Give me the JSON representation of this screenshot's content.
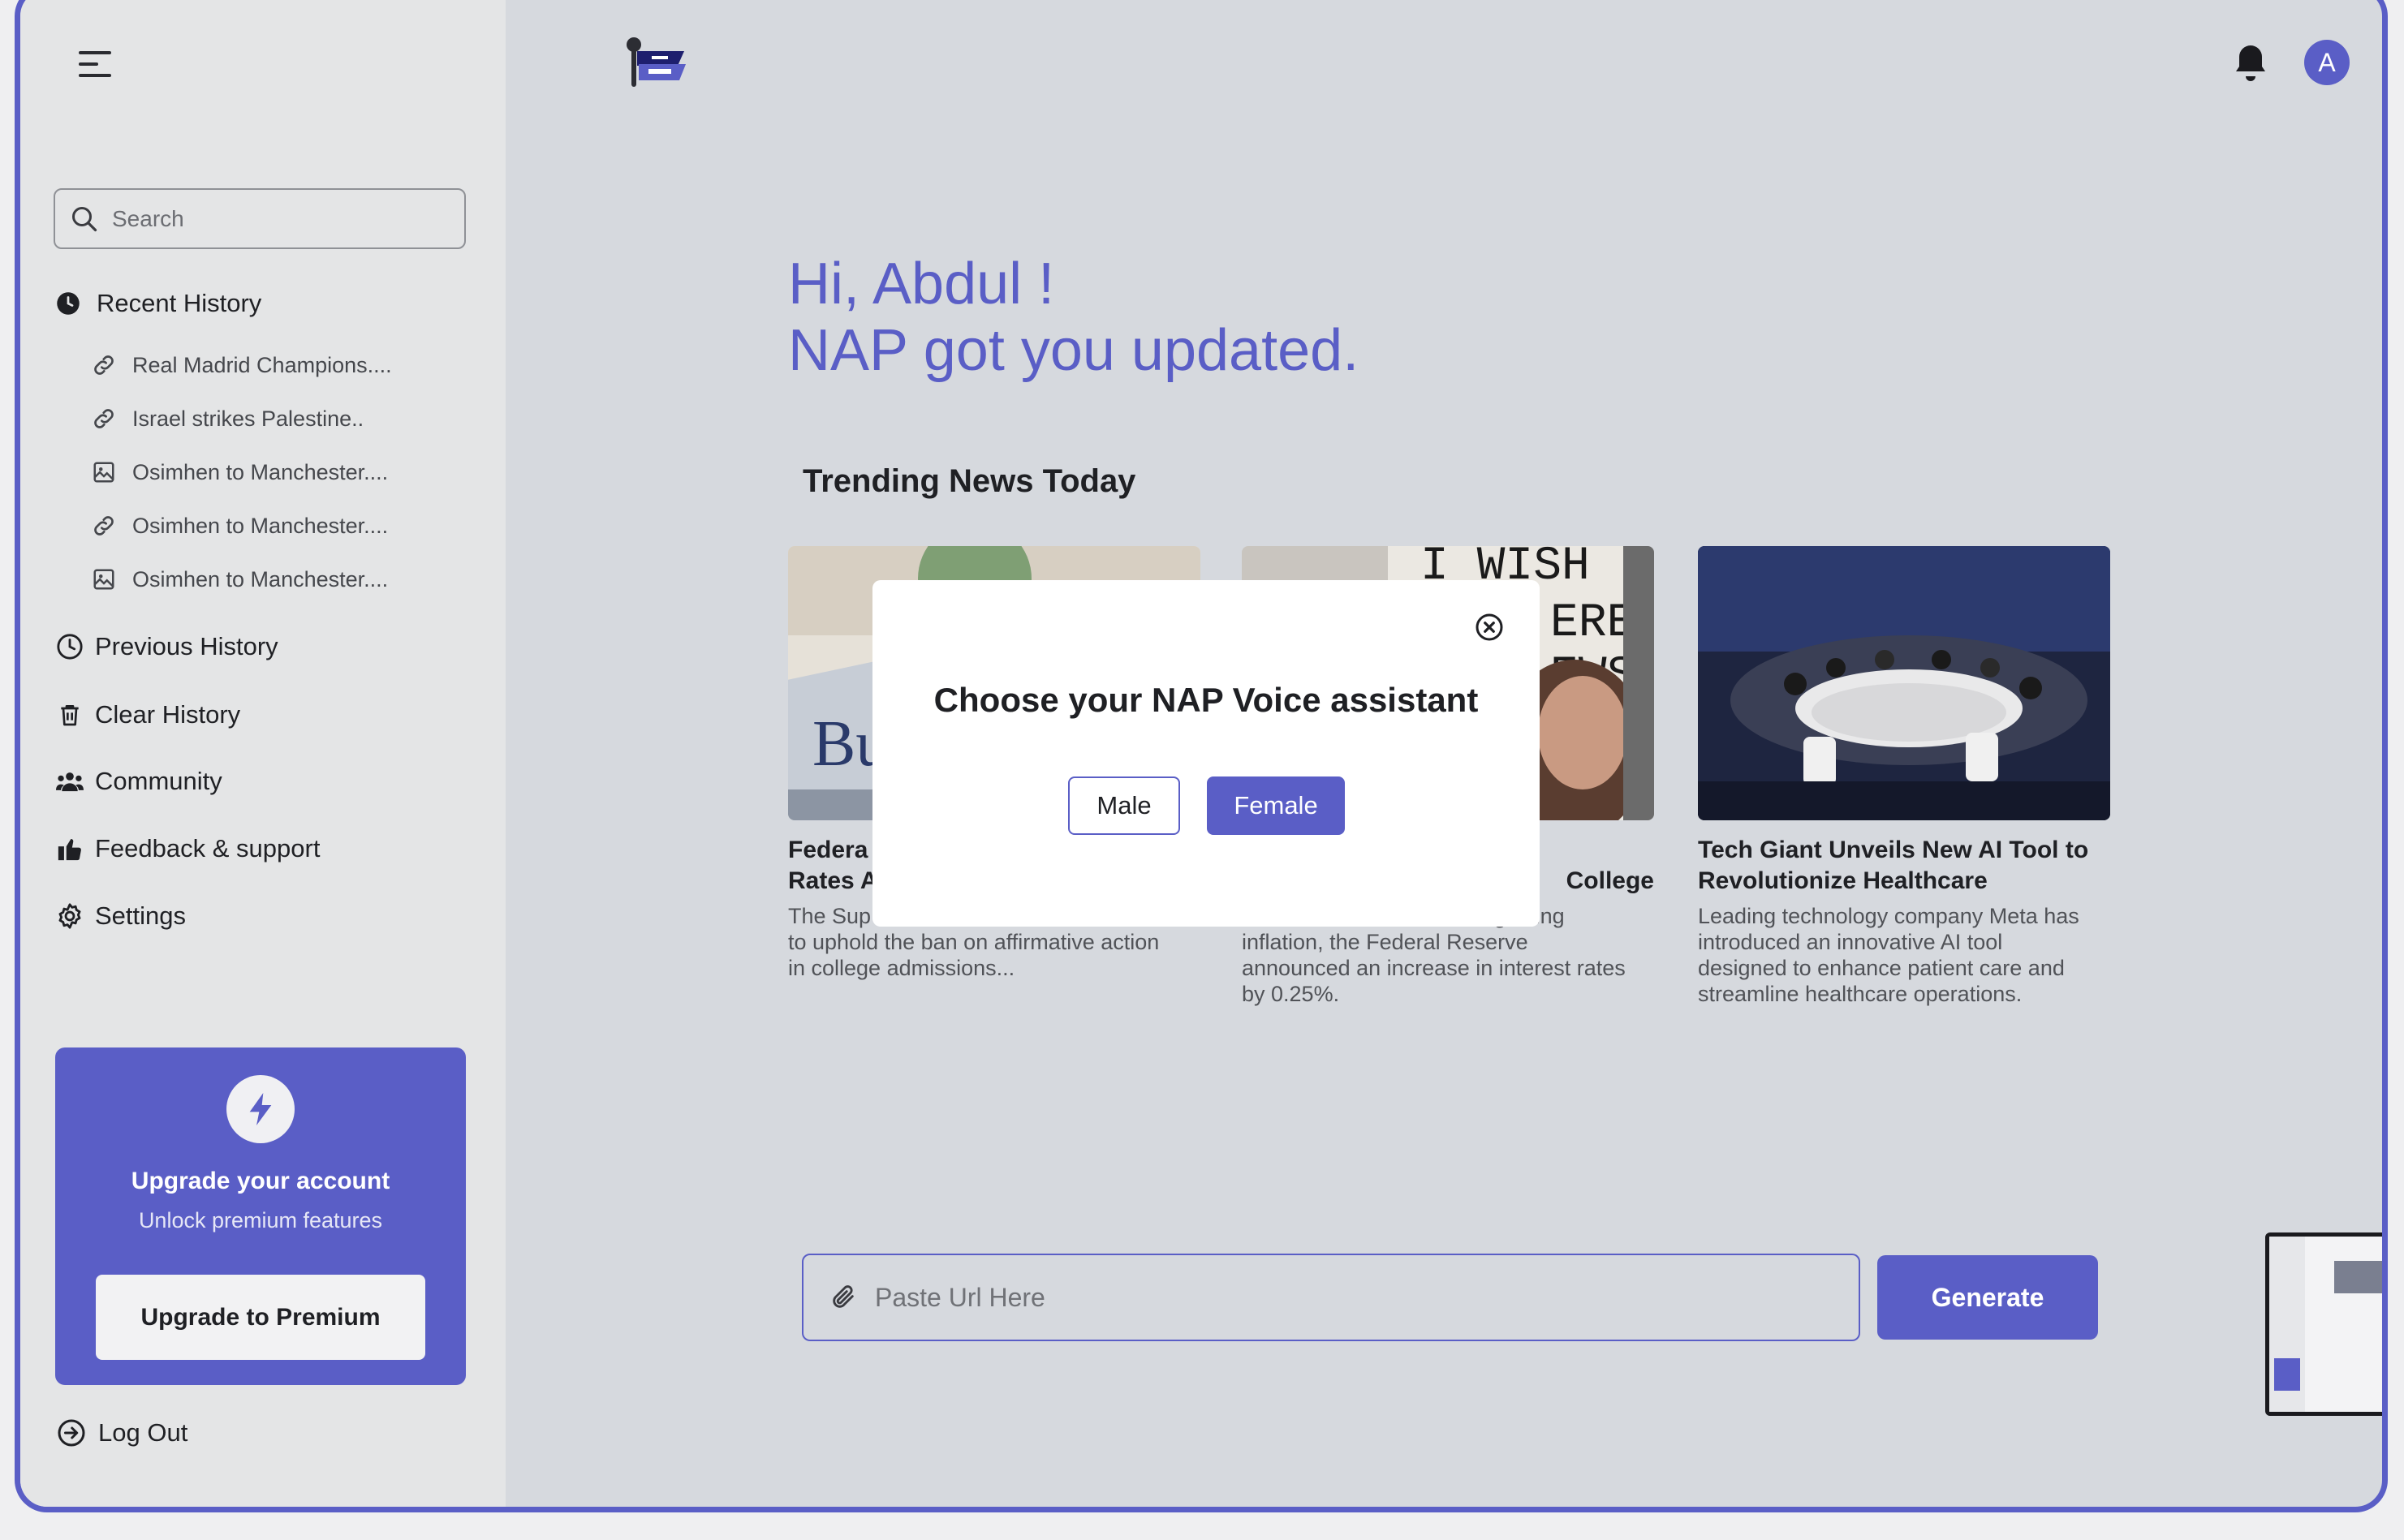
{
  "app": {
    "user_initial": "A"
  },
  "sidebar": {
    "search_placeholder": "Search",
    "recent_history_label": "Recent History",
    "recent_items": [
      {
        "label": "Real Madrid Champions....",
        "icon": "link-icon"
      },
      {
        "label": "Israel strikes Palestine..",
        "icon": "link-icon"
      },
      {
        "label": "Osimhen to Manchester....",
        "icon": "image-icon"
      },
      {
        "label": "Osimhen to Manchester....",
        "icon": "link-icon"
      },
      {
        "label": "Osimhen to Manchester....",
        "icon": "image-icon"
      }
    ],
    "previous_history_label": "Previous History",
    "clear_history_label": "Clear History",
    "community_label": "Community",
    "feedback_label": "Feedback & support",
    "settings_label": "Settings",
    "upgrade": {
      "title": "Upgrade your account",
      "subtitle": "Unlock premium features",
      "button_label": "Upgrade to Premium"
    },
    "logout_label": "Log Out"
  },
  "main": {
    "greeting_line1": "Hi, Abdul !",
    "greeting_line2": "NAP got you updated.",
    "trending_title": "Trending News Today",
    "cards": [
      {
        "title": "Federa                                             Rates A",
        "title_line1": "Federa",
        "title_line2": "Rates A",
        "desc_line1": "The Sup",
        "desc_line2": "to uphold the ban on affirmative action",
        "desc_line3": "in college admissions..."
      },
      {
        "title_visible": "College",
        "desc_line1": "In a move aimed at curbing rising",
        "desc_line2": "inflation, the Federal Reserve",
        "desc_line3": "announced an increase in interest rates",
        "desc_line4": "by 0.25%."
      },
      {
        "title_line1": "Tech Giant Unveils New AI Tool to",
        "title_line2": "Revolutionize Healthcare",
        "desc_line1": "Leading technology company Meta has",
        "desc_line2": "introduced an innovative AI tool",
        "desc_line3": "designed to enhance patient care and",
        "desc_line4": "streamline healthcare operations."
      }
    ],
    "url_placeholder": "Paste Url Here",
    "generate_label": "Generate"
  },
  "modal": {
    "title": "Choose your NAP Voice assistant",
    "male_label": "Male",
    "female_label": "Female"
  },
  "colors": {
    "accent": "#5a5ec6",
    "sidebar_bg": "#e4e5e6",
    "main_bg": "#d6d9de"
  }
}
